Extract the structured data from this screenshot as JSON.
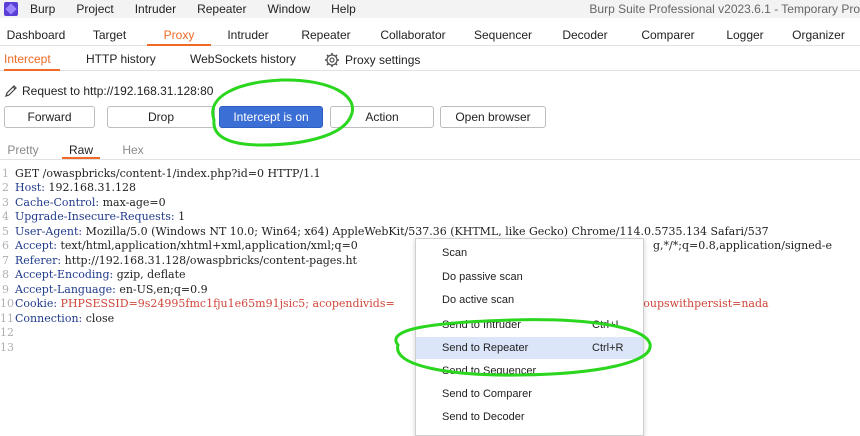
{
  "window": {
    "title": "Burp Suite Professional v2023.6.1 - Temporary Pro"
  },
  "menubar": {
    "items": [
      "Burp",
      "Project",
      "Intruder",
      "Repeater",
      "Window",
      "Help"
    ]
  },
  "top_tabs": [
    "Dashboard",
    "Target",
    "Proxy",
    "Intruder",
    "Repeater",
    "Collaborator",
    "Sequencer",
    "Decoder",
    "Comparer",
    "Logger",
    "Organizer"
  ],
  "active_top_tab": "Proxy",
  "sub_tabs": [
    "Intercept",
    "HTTP history",
    "WebSockets history"
  ],
  "active_sub_tab": "Intercept",
  "proxy_settings_label": "Proxy settings",
  "request_line": "Request to http://192.168.31.128:80",
  "buttons": {
    "forward": "Forward",
    "drop": "Drop",
    "intercept": "Intercept is on",
    "action": "Action",
    "open_browser": "Open browser"
  },
  "editor_tabs": [
    "Pretty",
    "Raw",
    "Hex"
  ],
  "active_editor_tab": "Raw",
  "request": [
    {
      "n": "1",
      "key": "",
      "val": "GET /owaspbricks/content-1/index.php?id=0 HTTP/1.1"
    },
    {
      "n": "2",
      "key": "Host:",
      "val": " 192.168.31.128"
    },
    {
      "n": "3",
      "key": "Cache-Control:",
      "val": " max-age=0"
    },
    {
      "n": "4",
      "key": "Upgrade-Insecure-Requests:",
      "val": " 1"
    },
    {
      "n": "5",
      "key": "User-Agent:",
      "val": " Mozilla/5.0 (Windows NT 10.0; Win64; x64) AppleWebKit/537.36 (KHTML, like Gecko) Chrome/114.0.5735.134 Safari/537"
    },
    {
      "n": "6",
      "key": "Accept:",
      "val": " text/html,application/xhtml+xml,application/xml;q=0",
      "tail": "g,*/*;q=0.8,application/signed-e"
    },
    {
      "n": "7",
      "key": "Referer:",
      "val": " http://192.168.31.128/owaspbricks/content-pages.ht"
    },
    {
      "n": "8",
      "key": "Accept-Encoding:",
      "val": " gzip, deflate"
    },
    {
      "n": "9",
      "key": "Accept-Language:",
      "val": " en-US,en;q=0.9"
    },
    {
      "n": "10",
      "key": "Cookie:",
      "val": " PHPSESSID=9s24995fmc1fju1e65m91jsic5; acopendivids=",
      "tail": "roupswithpersist=nada"
    },
    {
      "n": "11",
      "key": "Connection:",
      "val": " close"
    },
    {
      "n": "12",
      "key": "",
      "val": ""
    },
    {
      "n": "13",
      "key": "",
      "val": ""
    }
  ],
  "context_menu": {
    "items": [
      {
        "label": "Scan",
        "shortcut": ""
      },
      {
        "label": "Do passive scan",
        "shortcut": ""
      },
      {
        "label": "Do active scan",
        "shortcut": ""
      },
      {
        "label": "Send to Intruder",
        "shortcut": "Ctrl+I"
      },
      {
        "label": "Send to Repeater",
        "shortcut": "Ctrl+R"
      },
      {
        "label": "Send to Sequencer",
        "shortcut": ""
      },
      {
        "label": "Send to Comparer",
        "shortcut": ""
      },
      {
        "label": "Send to Decoder",
        "shortcut": ""
      }
    ],
    "highlighted": "Send to Repeater"
  },
  "colors": {
    "accent": "#ef6a27",
    "intercept_on": "#3b6fd6",
    "annotation": "#2bd61e",
    "menu_highlight": "#dbe6f8"
  },
  "icons": [
    "burp-logo-icon",
    "gear-icon",
    "pencil-icon"
  ]
}
